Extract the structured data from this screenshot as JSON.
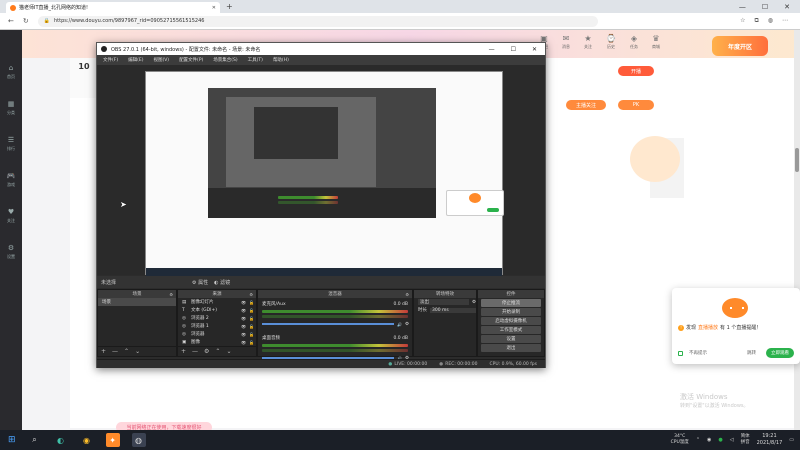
{
  "browser": {
    "tab_title": "猫老师IT直播_北孔网络的知道!",
    "url": "https://www.douyu.com/9897967_rid=09052715561515246",
    "new_tab": "+",
    "min": "—",
    "max": "☐",
    "close": "✕"
  },
  "left_nav": [
    {
      "icon": "⌂",
      "label": "首页"
    },
    {
      "icon": "▦",
      "label": "分类"
    },
    {
      "icon": "☰",
      "label": "排行"
    },
    {
      "icon": "🎮",
      "label": "游戏"
    },
    {
      "icon": "♥",
      "label": "关注"
    },
    {
      "icon": "⚙",
      "label": "设置"
    }
  ],
  "site_header": {
    "items": [
      {
        "icon": "▣",
        "label": "鱼吧"
      },
      {
        "icon": "✉",
        "label": "消息"
      },
      {
        "icon": "★",
        "label": "关注"
      },
      {
        "icon": "⌚",
        "label": "历史"
      },
      {
        "icon": "◈",
        "label": "任务"
      },
      {
        "icon": "♛",
        "label": "商城"
      }
    ],
    "zone_badge": "年度开区",
    "start_live": "开播"
  },
  "page_side": {
    "pk_label": "PK",
    "follow_label": "主播关注",
    "num": "10"
  },
  "obs": {
    "title": "OBS 27.0.1 (64-bit, windows) - 配置文件: 未命名 - 场景: 未命名",
    "menu": [
      "文件(F)",
      "编辑(E)",
      "视图(V)",
      "配置文件(P)",
      "场景集合(S)",
      "工具(T)",
      "帮助(H)"
    ],
    "scene_bar": {
      "scene_label": "未选择",
      "properties": "属性",
      "filters": "滤镜"
    },
    "scenes": {
      "header": "场景",
      "items": [
        "场景"
      ]
    },
    "sources": {
      "header": "来源",
      "items": [
        {
          "name": "图像幻灯片",
          "icon": "▤"
        },
        {
          "name": "文本 (GDI+)",
          "icon": "T"
        },
        {
          "name": "浏览器 2",
          "icon": "◎"
        },
        {
          "name": "浏览器 1",
          "icon": "◎"
        },
        {
          "name": "浏览器",
          "icon": "◎"
        },
        {
          "name": "图像",
          "icon": "▣"
        }
      ]
    },
    "mixer": {
      "header": "混音器",
      "channels": [
        {
          "name": "麦克风/Aux",
          "db": "0.0 dB"
        },
        {
          "name": "桌面音频",
          "db": "0.0 dB"
        }
      ]
    },
    "transitions": {
      "header": "转场特效",
      "type": "淡出",
      "duration_label": "时长",
      "duration": "300 ms"
    },
    "controls": {
      "header": "控件",
      "buttons": [
        "停止推流",
        "开始录制",
        "启动虚拟摄像机",
        "工作室模式",
        "设置",
        "退出"
      ]
    },
    "status": {
      "live": "LIVE: 00:00:00",
      "rec": "REC: 00:00:00",
      "cpu": "CPU: 0.9%, 60.00 fps"
    }
  },
  "notification": {
    "text_pre": "发现",
    "text_highlight": "直播播放",
    "text_post": "有 1 个直播提醒！",
    "dont_show": "不再提示",
    "later": "跳转",
    "go": "立即观看"
  },
  "watermark": {
    "line1": "激活 Windows",
    "line2": "转到\"设置\"以激活 Windows。"
  },
  "status_bubble": "当前网络正在使用，下载速度很好",
  "taskbar": {
    "weather_temp": "34°C",
    "weather_desc": "CPU温度",
    "ime_top": "简体",
    "ime_bottom": "拼音",
    "time": "19:21",
    "date": "2021/8/17"
  }
}
